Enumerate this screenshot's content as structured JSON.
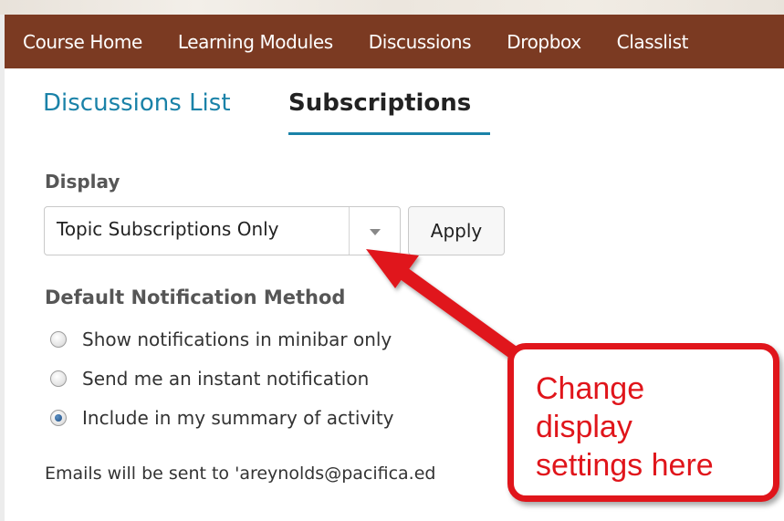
{
  "nav": {
    "items": [
      "Course Home",
      "Learning Modules",
      "Discussions",
      "Dropbox",
      "Classlist"
    ]
  },
  "tabs": {
    "list_label": "Discussions List",
    "subscriptions_label": "Subscriptions"
  },
  "display": {
    "label": "Display",
    "selected_value": "Topic Subscriptions Only",
    "apply_label": "Apply"
  },
  "notification": {
    "label": "Default Notification Method",
    "options": [
      {
        "label": "Show notifications in minibar only",
        "checked": false
      },
      {
        "label": "Send me an instant notification",
        "checked": false
      },
      {
        "label": "Include in my summary of activity",
        "checked": true
      }
    ]
  },
  "email_note": "Emails will be sent to 'areynolds@pacifica.ed",
  "callout": {
    "text": "Change\ndisplay\nsettings here"
  },
  "colors": {
    "nav_bg": "#7b3a22",
    "link_blue": "#1a82a8",
    "callout_red": "#e0151b"
  },
  "icons": {
    "select_caret": "chevron-down-icon",
    "arrow": "arrow-icon"
  }
}
